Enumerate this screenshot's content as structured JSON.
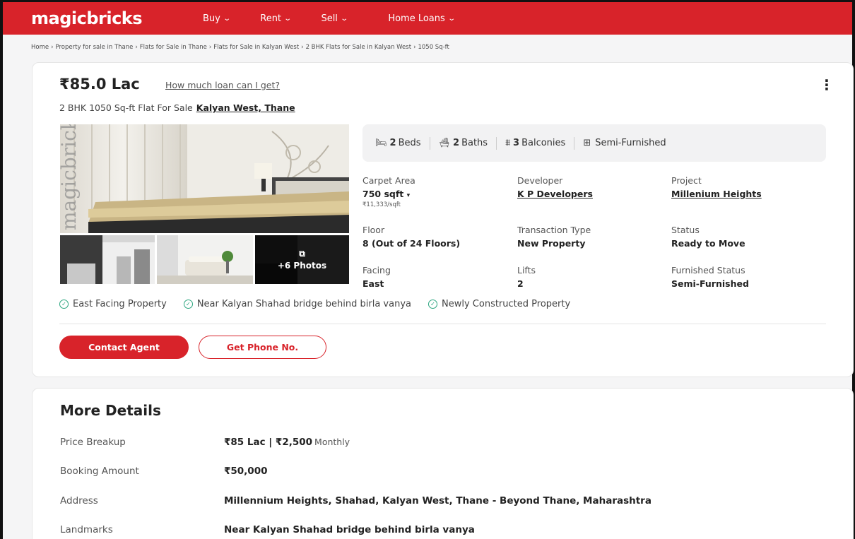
{
  "header": {
    "logo": "magicbricks",
    "nav": [
      {
        "label": "Buy"
      },
      {
        "label": "Rent"
      },
      {
        "label": "Sell"
      },
      {
        "label": "Home Loans"
      }
    ]
  },
  "breadcrumb": [
    "Home",
    "Property for sale in Thane",
    "Flats for Sale in Thane",
    "Flats for Sale in Kalyan West",
    "2 BHK Flats for Sale in Kalyan West",
    "1050 Sq-ft"
  ],
  "listing": {
    "price": "₹85.0 Lac",
    "loan_link": "How much loan can I get?",
    "subtitle": "2 BHK 1050 Sq-ft Flat For Sale",
    "location": "Kalyan West, Thane",
    "photos_more": "+6 Photos",
    "watermark": "magicbricks",
    "amenities": [
      {
        "count": "2",
        "label": "Beds",
        "icon": "bed-icon"
      },
      {
        "count": "2",
        "label": "Baths",
        "icon": "bath-icon"
      },
      {
        "count": "3",
        "label": "Balconies",
        "icon": "balcony-icon"
      },
      {
        "count": "",
        "label": "Semi-Furnished",
        "icon": "furnishing-icon"
      }
    ],
    "specs": {
      "carpet_area": {
        "label": "Carpet Area",
        "value": "750 sqft",
        "sub": "₹11,333/sqft"
      },
      "developer": {
        "label": "Developer",
        "value": "K P Developers"
      },
      "project": {
        "label": "Project",
        "value": "Millenium Heights"
      },
      "floor": {
        "label": "Floor",
        "value": "8 (Out of 24 Floors)"
      },
      "transaction": {
        "label": "Transaction Type",
        "value": "New Property"
      },
      "status": {
        "label": "Status",
        "value": "Ready to Move"
      },
      "facing": {
        "label": "Facing",
        "value": "East"
      },
      "lifts": {
        "label": "Lifts",
        "value": "2"
      },
      "furnished": {
        "label": "Furnished Status",
        "value": "Semi-Furnished"
      }
    },
    "highlights": [
      "East Facing Property",
      "Near Kalyan Shahad bridge behind birla vanya",
      "Newly Constructed Property"
    ],
    "buttons": {
      "contact": "Contact Agent",
      "phone": "Get Phone No."
    }
  },
  "more_details": {
    "title": "More Details",
    "rows": [
      {
        "label": "Price Breakup",
        "value": "₹85 Lac | ₹2,500",
        "extra": "Monthly"
      },
      {
        "label": "Booking Amount",
        "value": "₹50,000"
      },
      {
        "label": "Address",
        "value": "Millennium Heights, Shahad, Kalyan West, Thane - Beyond Thane, Maharashtra"
      },
      {
        "label": "Landmarks",
        "value": "Near Kalyan Shahad bridge behind birla vanya"
      }
    ]
  },
  "colors": {
    "brand": "#d8232a",
    "check": "#2aa57e"
  }
}
